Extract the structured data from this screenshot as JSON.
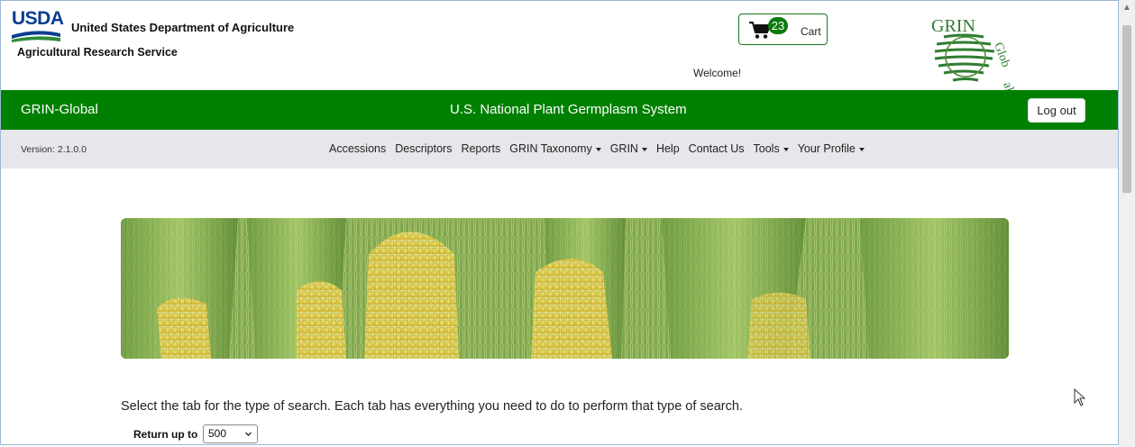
{
  "header": {
    "usda_logo_text": "USDA",
    "department": "United States Department of Agriculture",
    "agency": "Agricultural Research Service",
    "cart": {
      "count": "23",
      "label": "Cart"
    },
    "welcome": "Welcome!",
    "grin_logo_text": "GRIN-Global"
  },
  "greenbar": {
    "brand": "GRIN-Global",
    "system_title": "U.S. National Plant Germplasm System",
    "logout_label": "Log out"
  },
  "navbar": {
    "version": "Version: 2.1.0.0",
    "items": [
      {
        "label": "Accessions",
        "dropdown": false
      },
      {
        "label": "Descriptors",
        "dropdown": false
      },
      {
        "label": "Reports",
        "dropdown": false
      },
      {
        "label": "GRIN Taxonomy",
        "dropdown": true
      },
      {
        "label": "GRIN",
        "dropdown": true
      },
      {
        "label": "Help",
        "dropdown": false
      },
      {
        "label": "Contact Us",
        "dropdown": false
      },
      {
        "label": "Tools",
        "dropdown": true
      },
      {
        "label": "Your Profile",
        "dropdown": true
      }
    ]
  },
  "main": {
    "instructions": "Select the tab for the type of search. Each tab has everything you need to do to perform that type of search.",
    "return_label": "Return up to",
    "return_value": "500"
  },
  "colors": {
    "brand_green": "#008000",
    "nav_bg": "#e7e7eb",
    "usda_blue": "#0b3d91"
  }
}
